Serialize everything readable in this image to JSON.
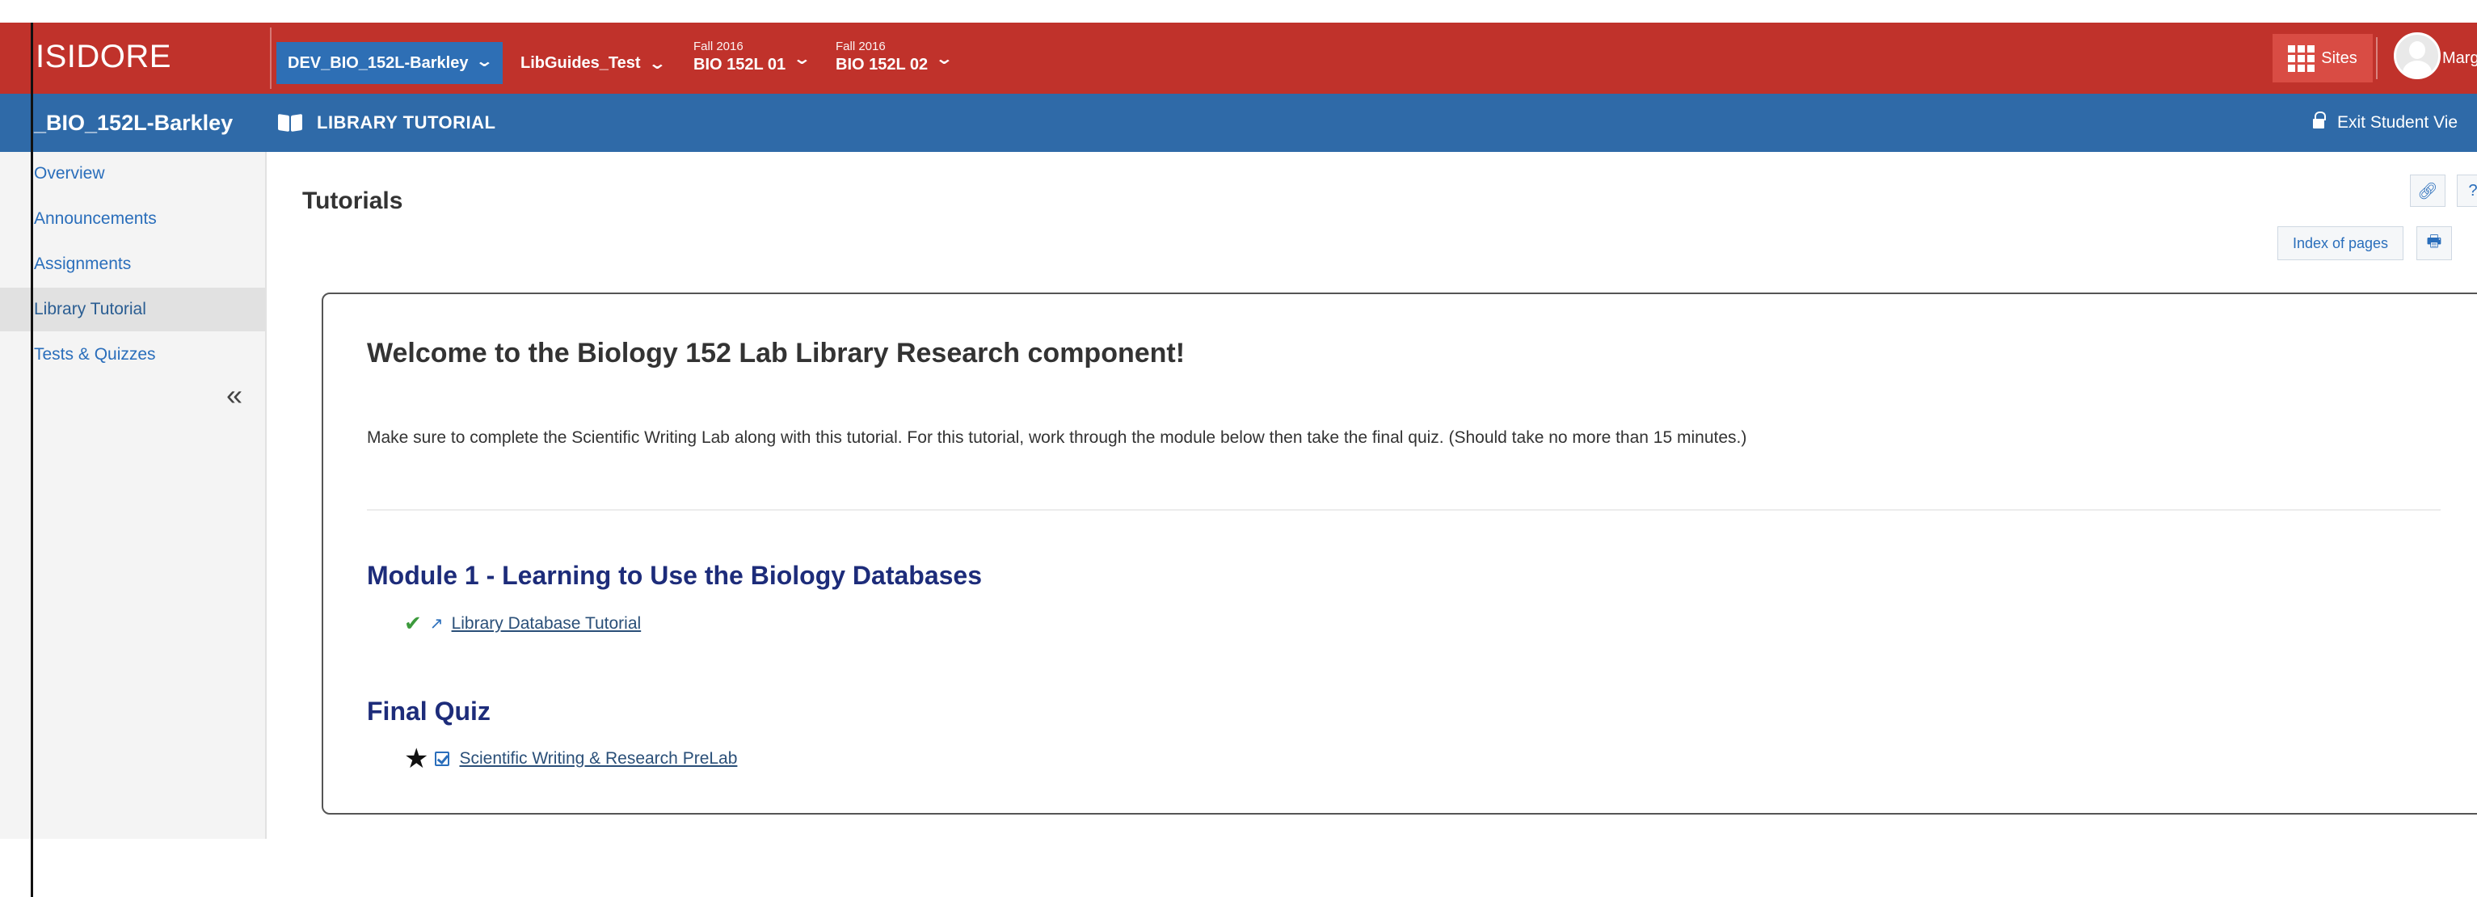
{
  "app": {
    "brand": "ISIDORE",
    "colors": {
      "topbar": "#c0322b",
      "titlebar": "#2f6aa8",
      "heading": "#1d2c7a",
      "check": "#3c9a3c"
    }
  },
  "header": {
    "site_tabs": [
      {
        "term": "",
        "label": "DEV_BIO_152L-Barkley",
        "active": true
      },
      {
        "term": "",
        "label": "LibGuides_Test",
        "active": false
      },
      {
        "term": "Fall 2016",
        "label": "BIO 152L 01",
        "active": false
      },
      {
        "term": "Fall 2016",
        "label": "BIO 152L 02",
        "active": false
      }
    ],
    "sites_label": "Sites",
    "user_name": "Marg"
  },
  "titlebar": {
    "site_title": "_BIO_152L-Barkley",
    "tool_title": "LIBRARY TUTORIAL",
    "exit_label": "Exit Student Vie"
  },
  "sidebar": {
    "items": [
      {
        "label": "Overview",
        "active": false
      },
      {
        "label": "Announcements",
        "active": false
      },
      {
        "label": "Assignments",
        "active": false
      },
      {
        "label": "Library Tutorial",
        "active": true
      },
      {
        "label": "Tests & Quizzes",
        "active": false
      }
    ],
    "collapse_glyph": "«"
  },
  "main": {
    "page_heading": "Tutorials",
    "index_label": "Index of pages",
    "welcome": "Welcome to the Biology 152 Lab Library Research component!",
    "intro": "Make sure to complete the Scientific Writing Lab along with this tutorial.  For this tutorial, work through the module below then take the final quiz. (Should take no more than 15 minutes.)",
    "module_title": "Module 1 - Learning to Use the Biology Databases",
    "module_item": "Library Database Tutorial",
    "quiz_title": "Final Quiz",
    "quiz_item": "Scientific Writing & Research PreLab",
    "help_glyph": "?"
  }
}
